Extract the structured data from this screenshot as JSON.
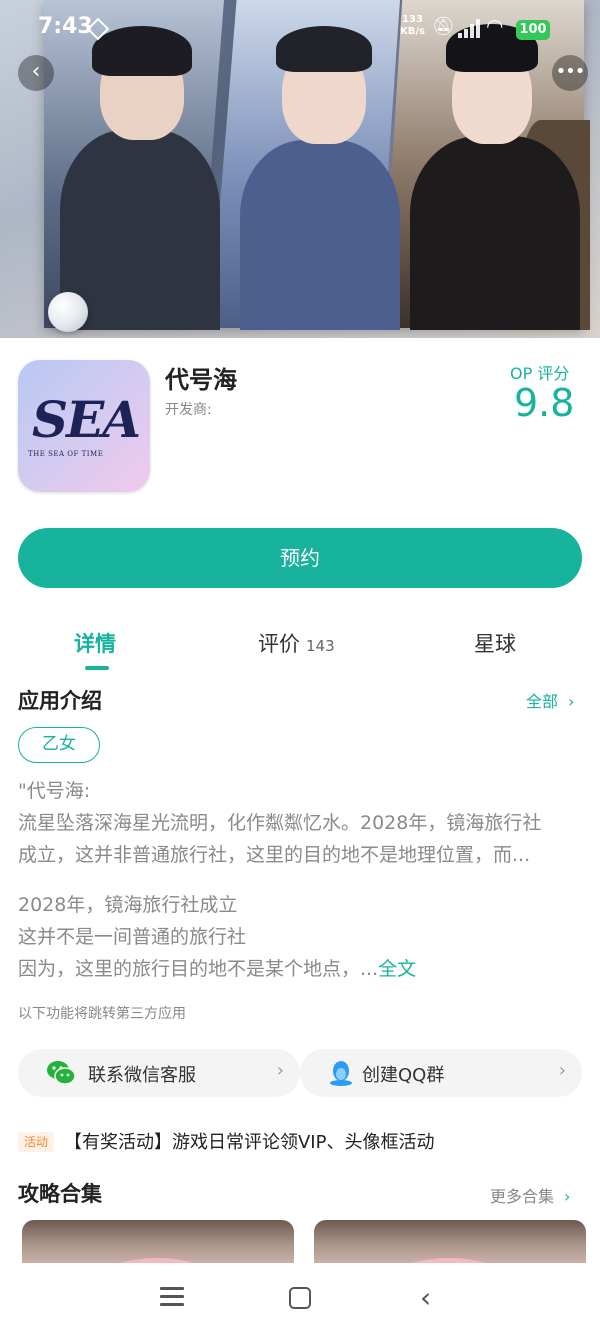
{
  "status_bar": {
    "time": "7:43",
    "net_speed_value": "133",
    "net_speed_unit": "KB/s",
    "battery": "100"
  },
  "banner": {
    "back_icon": "chevron-left-icon",
    "more_icon": "more-horizontal-icon"
  },
  "app": {
    "name": "代号海",
    "developer_label": "开发商:",
    "icon_text": "SEA",
    "icon_subtext": "THE SEA OF TIME",
    "score_label": "OP 评分",
    "score_value": "9.8"
  },
  "actions": {
    "reserve_label": "预约"
  },
  "tabs": [
    {
      "label": "详情",
      "active": true
    },
    {
      "label": "评价",
      "count": "143"
    },
    {
      "label": "星球"
    }
  ],
  "intro": {
    "title": "应用介绍",
    "all_label": "全部",
    "tag": "乙女",
    "lines": [
      "\"代号海:",
      "流星坠落深海星光流明，化作粼粼忆水。2028年，镜海旅行社",
      "成立，这并非普通旅行社，这里的目的地不是地理位置，而...",
      "2028年，镜海旅行社成立",
      "这并不是一间普通的旅行社",
      "因为，这里的旅行目的地不是某个地点，..."
    ],
    "full_text_label": "全文",
    "third_party_notice": "以下功能将跳转第三方应用"
  },
  "third_party": {
    "wechat_label": "联系微信客服",
    "qq_label": "创建QQ群"
  },
  "activity": {
    "badge": "活动",
    "text": "【有奖活动】游戏日常评论领VIP、头像框活动"
  },
  "guides": {
    "title": "攻略合集",
    "more_label": "更多合集"
  },
  "colors": {
    "accent": "#17b39c",
    "activity_badge": "#f08a3c"
  }
}
